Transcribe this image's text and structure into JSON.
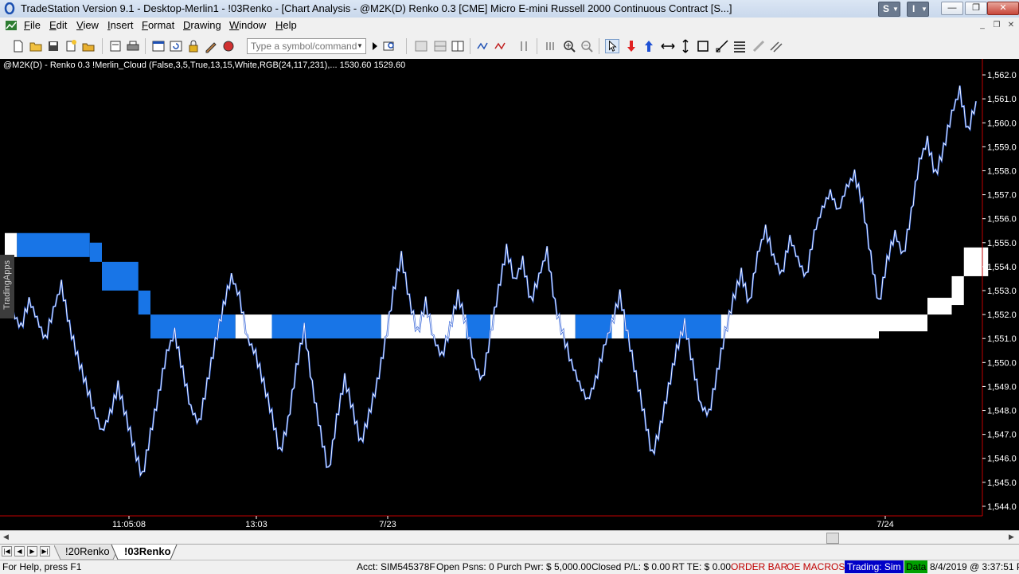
{
  "window": {
    "title": "TradeStation Version 9.1 - Desktop-Merlin1 - !03Renko - [Chart Analysis - @M2K(D) Renko 0.3 [CME] Micro E-mini Russell 2000 Continuous Contract [S...]",
    "badge_s": "S",
    "badge_i": "I",
    "minimize": "—",
    "restore": "❐",
    "close": "✕"
  },
  "menu": [
    "File",
    "Edit",
    "View",
    "Insert",
    "Format",
    "Drawing",
    "Window",
    "Help"
  ],
  "toolbar": {
    "symbol_placeholder": "Type a symbol/command"
  },
  "chart": {
    "status_line": "@M2K(D) - Renko 0.3  !Merlin_Cloud (False,3,5,True,13,15,White,RGB(24,117,231),...   1530.60  1529.60",
    "watermark": "TradingApps",
    "y_ticks": [
      "1,562.0",
      "1,561.0",
      "1,560.0",
      "1,559.0",
      "1,558.0",
      "1,557.0",
      "1,556.0",
      "1,555.0",
      "1,554.0",
      "1,553.0",
      "1,552.0",
      "1,551.0",
      "1,550.0",
      "1,549.0",
      "1,548.0",
      "1,547.0",
      "1,546.0",
      "1,545.0",
      "1,544.0"
    ],
    "x_ticks": [
      "11:05:08",
      "13:03",
      "7/23",
      "7/24"
    ],
    "colors": {
      "background": "#000000",
      "cloud_blue": "#1875e7",
      "cloud_white": "#ffffff",
      "bar_line": "#ffffff",
      "bar_down": "#2a5cd6",
      "axis_line": "#c00000"
    }
  },
  "tabs": {
    "active": "!03Renko",
    "inactive": "!20Renko"
  },
  "status": {
    "help": "For Help, press F1",
    "acct": "Acct: SIM545378F",
    "open_psns": "Open Psns: 0",
    "purch_pwr": "Purch Pwr: $ 5,000.00",
    "closed_pl": "Closed P/L: $ 0.00",
    "rt_te": "RT TE: $ 0.00",
    "order_bar": "ORDER BAR",
    "oe_macros": "OE MACROS",
    "trading": "Trading: Sim",
    "data": "Data",
    "datetime": "8/4/2019 @ 3:37:51 PM"
  },
  "chart_data": {
    "type": "line",
    "ylim": [
      1543.6,
      1562.4
    ],
    "x": [
      "11:05:08",
      "13:03",
      "7/23",
      "7/24"
    ],
    "price_path": [
      1552.8,
      1552.1,
      1551.4,
      1552.6,
      1551.8,
      1550.9,
      1552.2,
      1553.2,
      1551.5,
      1550.2,
      1549.1,
      1548.0,
      1547.1,
      1547.8,
      1549.0,
      1547.7,
      1546.4,
      1545.2,
      1547.0,
      1548.6,
      1550.4,
      1551.2,
      1549.6,
      1548.1,
      1547.4,
      1549.1,
      1550.8,
      1552.3,
      1553.6,
      1552.7,
      1551.0,
      1550.3,
      1549.1,
      1547.8,
      1546.2,
      1547.5,
      1549.7,
      1551.4,
      1549.0,
      1547.1,
      1545.4,
      1547.6,
      1549.3,
      1548.0,
      1546.6,
      1547.8,
      1549.1,
      1550.8,
      1552.9,
      1554.4,
      1552.6,
      1551.2,
      1552.5,
      1551.0,
      1550.2,
      1551.4,
      1552.8,
      1551.6,
      1550.0,
      1549.2,
      1551.1,
      1553.0,
      1554.7,
      1553.4,
      1554.2,
      1552.5,
      1553.6,
      1554.6,
      1552.4,
      1551.1,
      1550.0,
      1549.1,
      1548.4,
      1549.2,
      1550.6,
      1551.6,
      1552.8,
      1551.1,
      1549.4,
      1547.8,
      1546.1,
      1547.3,
      1548.9,
      1550.5,
      1551.6,
      1549.9,
      1548.2,
      1547.8,
      1549.5,
      1551.2,
      1552.6,
      1553.7,
      1552.4,
      1554.5,
      1555.5,
      1554.4,
      1553.6,
      1555.2,
      1554.3,
      1553.5,
      1555.4,
      1556.4,
      1557.1,
      1556.3,
      1557.3,
      1557.8,
      1556.6,
      1554.4,
      1552.4,
      1554.2,
      1555.4,
      1554.4,
      1556.2,
      1558.4,
      1559.2,
      1557.8,
      1558.9,
      1560.4,
      1561.3,
      1559.6,
      1560.9
    ],
    "cloud": [
      {
        "from": 0,
        "to": 1,
        "low": 1554.4,
        "high": 1555.4,
        "color": "white"
      },
      {
        "from": 1,
        "to": 7,
        "low": 1554.4,
        "high": 1555.4,
        "color": "blue"
      },
      {
        "from": 7,
        "to": 8,
        "low": 1554.2,
        "high": 1555.0,
        "color": "blue"
      },
      {
        "from": 8,
        "to": 11,
        "low": 1553.0,
        "high": 1554.2,
        "color": "blue"
      },
      {
        "from": 11,
        "to": 12,
        "low": 1552.0,
        "high": 1553.0,
        "color": "blue"
      },
      {
        "from": 12,
        "to": 19,
        "low": 1551.0,
        "high": 1552.0,
        "color": "blue"
      },
      {
        "from": 19,
        "to": 22,
        "low": 1551.0,
        "high": 1552.0,
        "color": "white"
      },
      {
        "from": 22,
        "to": 31,
        "low": 1551.0,
        "high": 1552.0,
        "color": "blue"
      },
      {
        "from": 31,
        "to": 38,
        "low": 1551.0,
        "high": 1552.0,
        "color": "white"
      },
      {
        "from": 38,
        "to": 40,
        "low": 1551.0,
        "high": 1552.0,
        "color": "blue"
      },
      {
        "from": 40,
        "to": 47,
        "low": 1551.0,
        "high": 1552.0,
        "color": "white"
      },
      {
        "from": 47,
        "to": 50,
        "low": 1551.0,
        "high": 1552.0,
        "color": "blue"
      },
      {
        "from": 50,
        "to": 51,
        "low": 1551.0,
        "high": 1552.0,
        "color": "white"
      },
      {
        "from": 51,
        "to": 59,
        "low": 1551.0,
        "high": 1552.0,
        "color": "blue"
      },
      {
        "from": 59,
        "to": 72,
        "low": 1551.0,
        "high": 1552.0,
        "color": "white"
      },
      {
        "from": 72,
        "to": 76,
        "low": 1551.3,
        "high": 1552.0,
        "color": "white"
      },
      {
        "from": 76,
        "to": 78,
        "low": 1552.0,
        "high": 1552.7,
        "color": "white"
      },
      {
        "from": 78,
        "to": 79,
        "low": 1552.4,
        "high": 1553.6,
        "color": "white"
      },
      {
        "from": 79,
        "to": 81,
        "low": 1553.6,
        "high": 1554.8,
        "color": "white"
      }
    ]
  }
}
